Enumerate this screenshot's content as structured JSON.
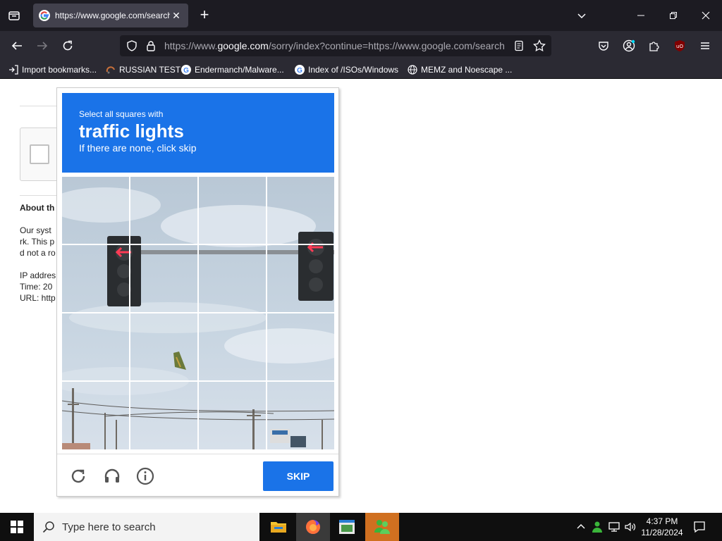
{
  "browser": {
    "tab": {
      "title": "https://www.google.com/search"
    },
    "url": {
      "prefix": "https://www.",
      "host": "google.com",
      "rest": "/sorry/index?continue=https://www.google.com/search"
    },
    "bookmarks": [
      {
        "label": "Import bookmarks..."
      },
      {
        "label": "RUSSIAN TEST"
      },
      {
        "label": "Endermanch/Malware..."
      },
      {
        "label": "Index of /ISOs/Windows"
      },
      {
        "label": "MEMZ and Noescape ..."
      }
    ]
  },
  "page": {
    "about_heading": "About th",
    "paragraph_lines": [
      "Our syst",
      "rk. This p",
      "d not a ro"
    ],
    "info_lines": [
      "IP addres",
      "Time: 20",
      "URL: http"
    ]
  },
  "captcha": {
    "instruction": "Select all squares with",
    "target": "traffic lights",
    "hint": "If there are none, click skip",
    "grid": {
      "rows": 4,
      "cols": 4
    },
    "skip_label": "SKIP",
    "footer_icons": [
      "reload-icon",
      "audio-icon",
      "info-icon"
    ]
  },
  "taskbar": {
    "search_placeholder": "Type here to search",
    "time": "4:37 PM",
    "date": "11/28/2024"
  },
  "colors": {
    "captcha_blue": "#1a73e8",
    "tab_bg": "#42414d",
    "toolbar_bg": "#2b2a33",
    "titlebar_bg": "#1c1b22"
  }
}
